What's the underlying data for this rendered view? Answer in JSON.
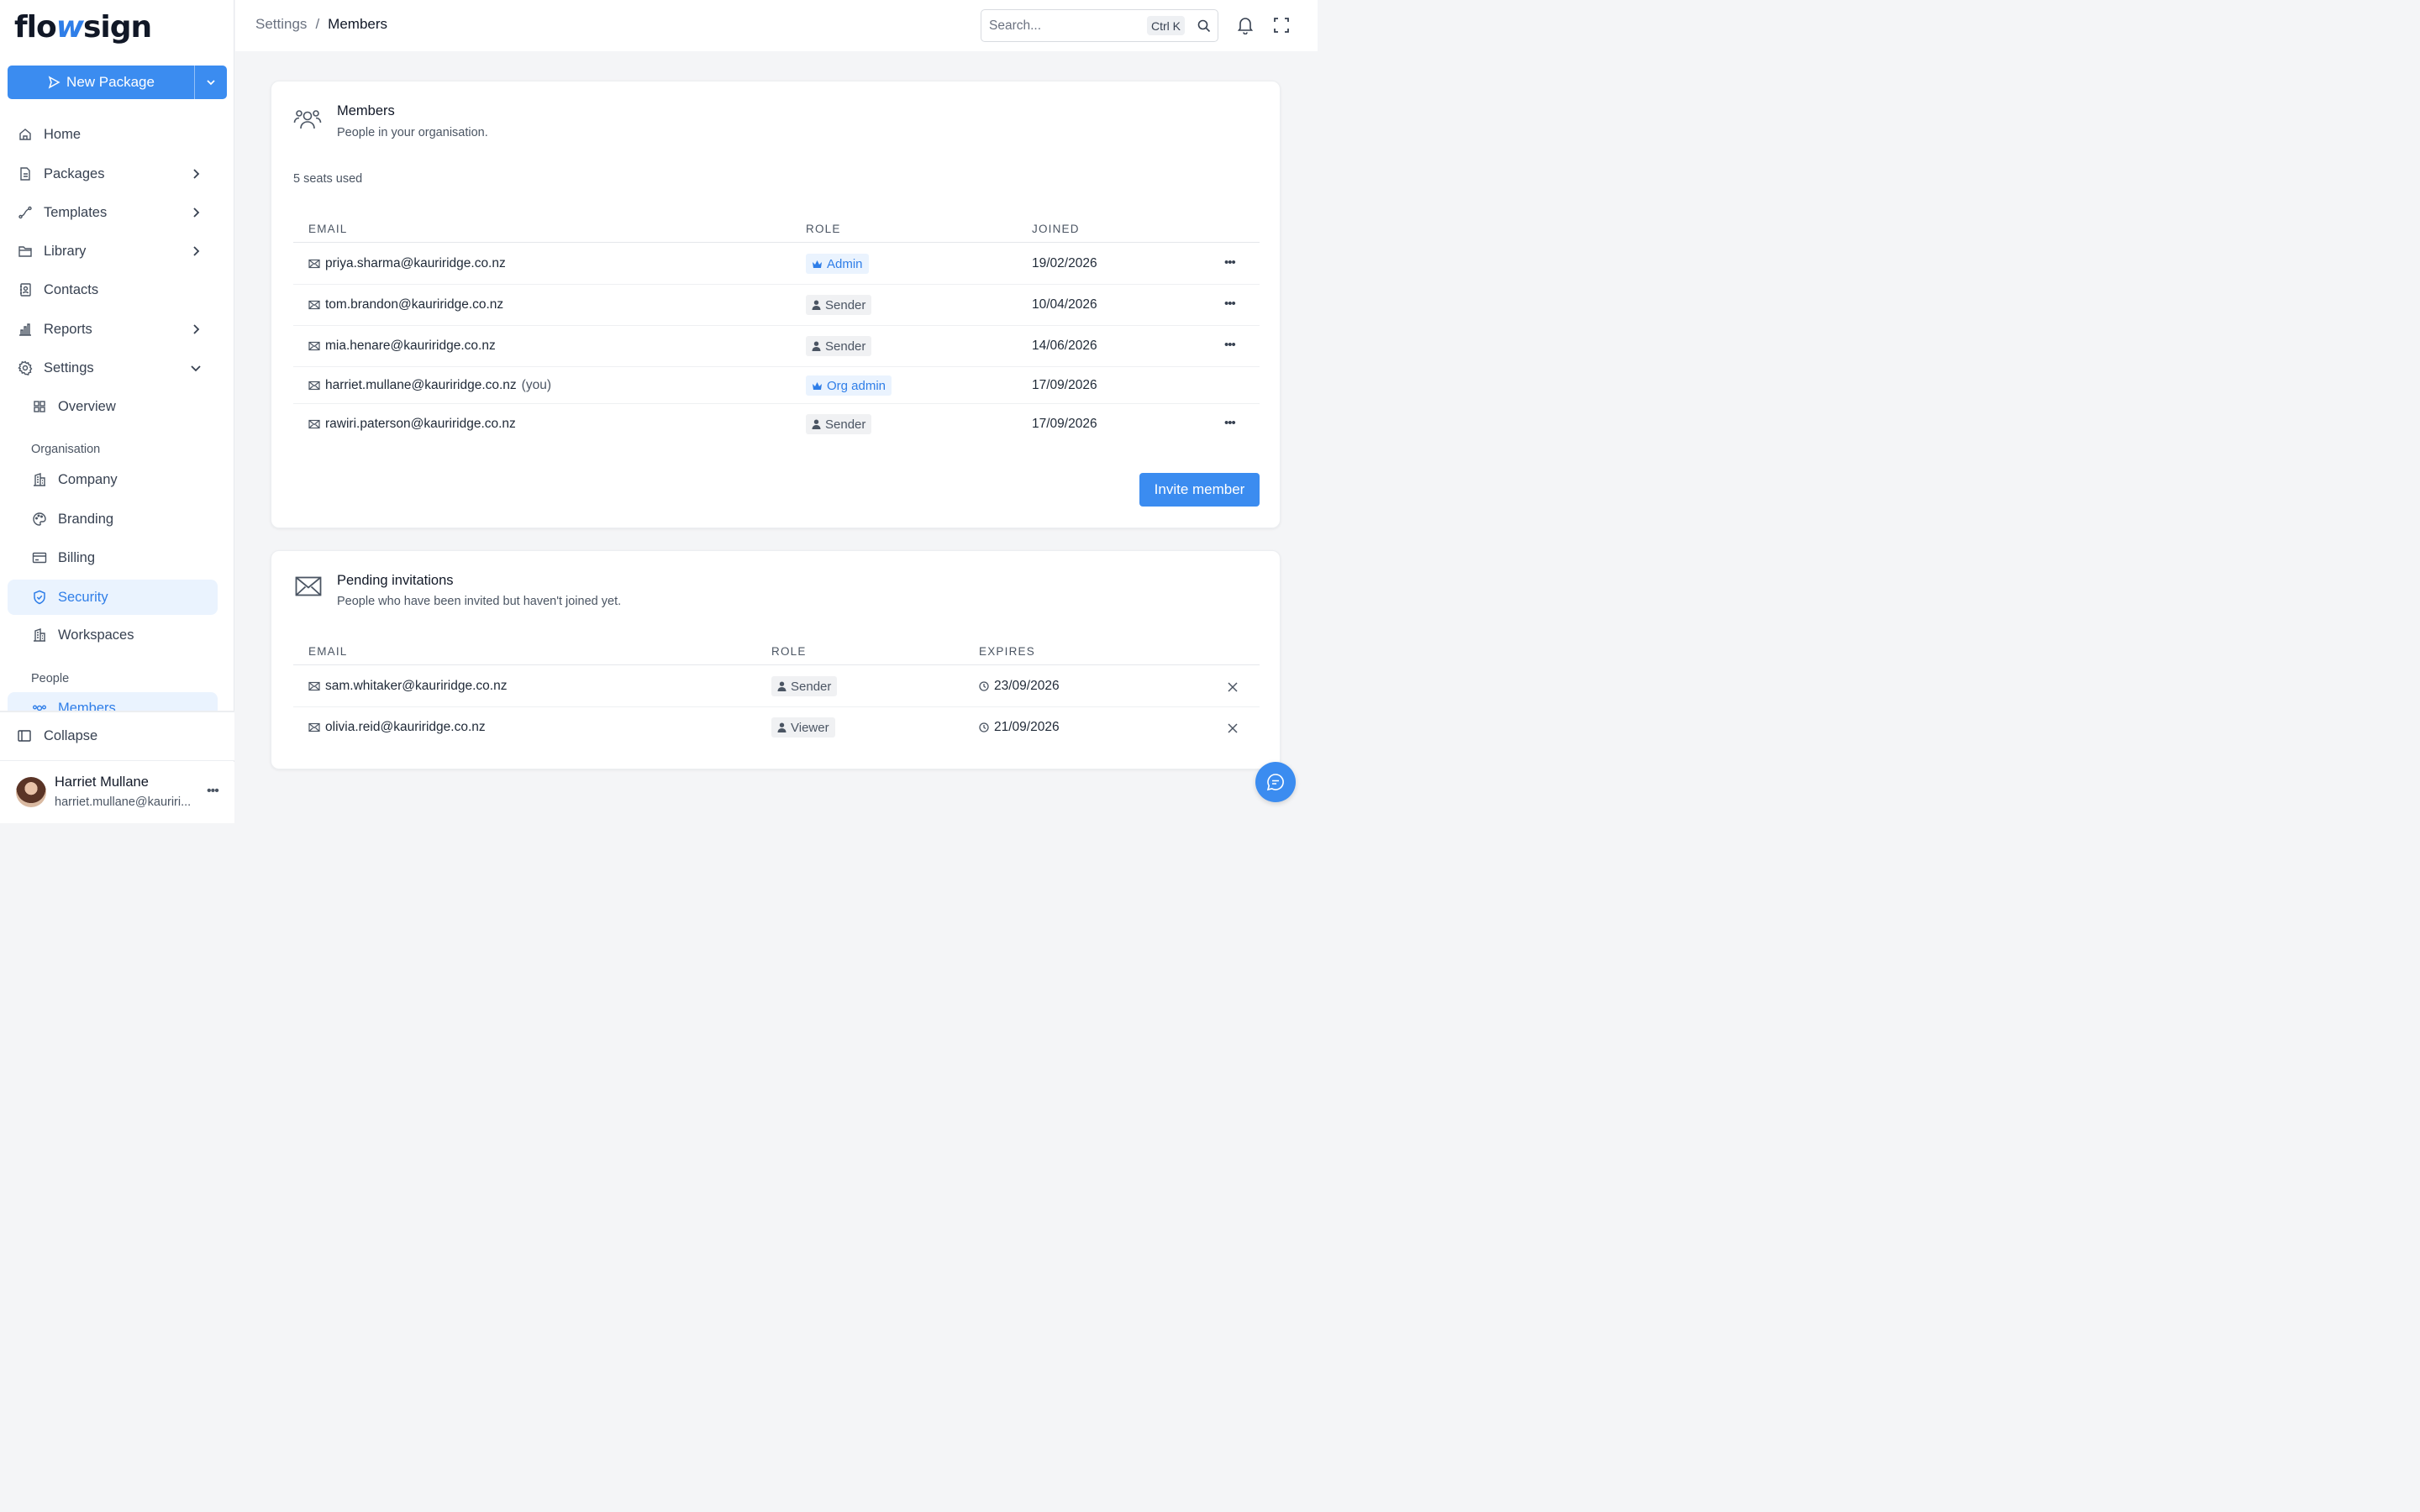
{
  "brand": {
    "logo_pre": "flo",
    "logo_mid": "w",
    "logo_post": "sign",
    "accent": "#3b8cf0"
  },
  "sidebar": {
    "new_package": "New Package",
    "items": [
      {
        "label": "Home",
        "icon": "home-icon"
      },
      {
        "label": "Packages",
        "icon": "document-icon"
      },
      {
        "label": "Templates",
        "icon": "route-icon"
      },
      {
        "label": "Library",
        "icon": "folder-icon"
      },
      {
        "label": "Contacts",
        "icon": "contact-book-icon"
      },
      {
        "label": "Reports",
        "icon": "bar-chart-icon"
      },
      {
        "label": "Settings",
        "icon": "gear-icon"
      },
      {
        "label": "Overview",
        "icon": "grid-icon"
      },
      {
        "label": "Company",
        "icon": "building-icon"
      },
      {
        "label": "Branding",
        "icon": "palette-icon"
      },
      {
        "label": "Billing",
        "icon": "credit-card-icon"
      },
      {
        "label": "Security",
        "icon": "shield-icon"
      },
      {
        "label": "Workspaces",
        "icon": "building-icon"
      },
      {
        "label": "Members",
        "icon": "users-icon"
      }
    ],
    "section_org": "Organisation",
    "section_people": "People",
    "collapse": "Collapse",
    "user": {
      "name": "Harriet Mullane",
      "email": "harriet.mullane@kauriri..."
    }
  },
  "topbar": {
    "breadcrumb_parent": "Settings",
    "breadcrumb_sep": "/",
    "breadcrumb_current": "Members",
    "search_placeholder": "Search...",
    "search_shortcut": "Ctrl K"
  },
  "members": {
    "title": "Members",
    "subtitle": "People in your organisation.",
    "seats": "5 seats used",
    "headers": {
      "email": "EMAIL",
      "role": "ROLE",
      "joined": "JOINED"
    },
    "rows": [
      {
        "email": "priya.sharma@kauriridge.co.nz",
        "role": "Admin",
        "joined": "19/02/2026"
      },
      {
        "email": "tom.brandon@kauriridge.co.nz",
        "role": "Sender",
        "joined": "10/04/2026"
      },
      {
        "email": "mia.henare@kauriridge.co.nz",
        "role": "Sender",
        "joined": "14/06/2026"
      },
      {
        "email": "harriet.mullane@kauriridge.co.nz",
        "you": "(you)",
        "role": "Org admin",
        "joined": "17/09/2026"
      },
      {
        "email": "rawiri.paterson@kauriridge.co.nz",
        "role": "Sender",
        "joined": "17/09/2026"
      }
    ],
    "invite_button": "Invite member"
  },
  "pending": {
    "title": "Pending invitations",
    "subtitle": "People who have been invited but haven't joined yet.",
    "headers": {
      "email": "EMAIL",
      "role": "ROLE",
      "expires": "EXPIRES"
    },
    "rows": [
      {
        "email": "sam.whitaker@kauriridge.co.nz",
        "role": "Sender",
        "expires": "23/09/2026"
      },
      {
        "email": "olivia.reid@kauriridge.co.nz",
        "role": "Viewer",
        "expires": "21/09/2026"
      }
    ]
  }
}
